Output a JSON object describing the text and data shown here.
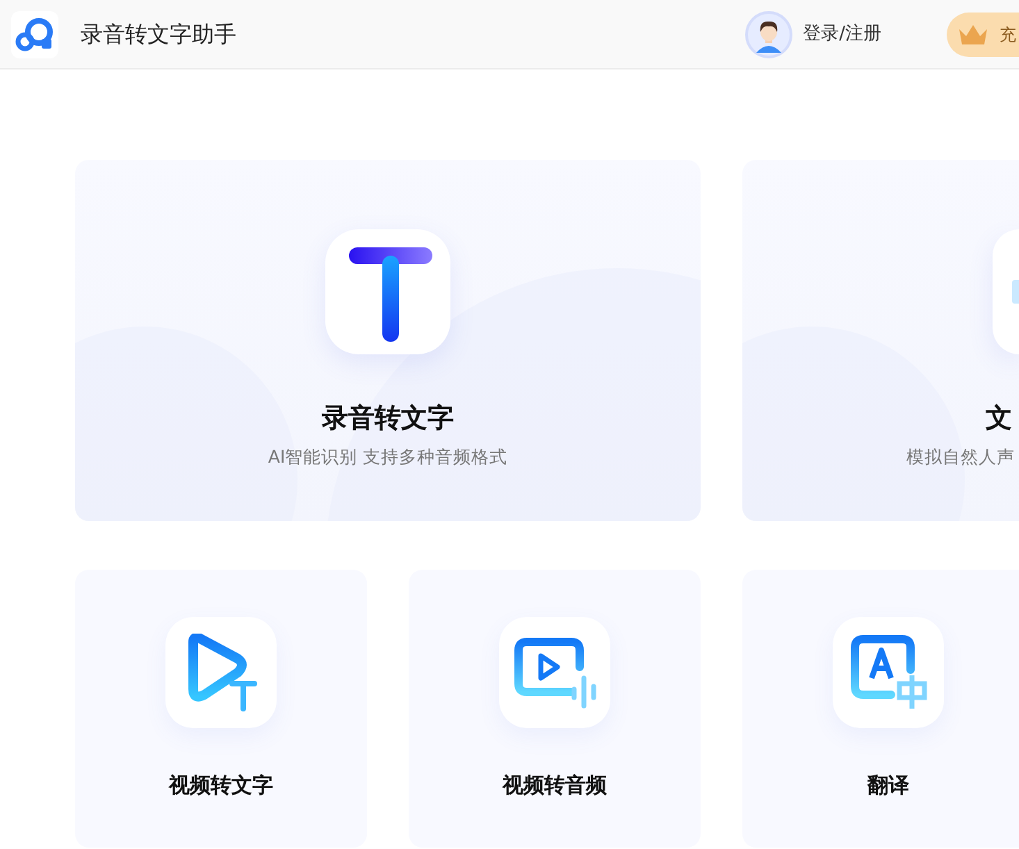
{
  "header": {
    "app_title": "录音转文字助手",
    "login": "登录/注册",
    "vip_button": "充"
  },
  "feature_cards": [
    {
      "title": "录音转文字",
      "subtitle": "AI智能识别 支持多种音频格式"
    },
    {
      "title": "文",
      "subtitle": "模拟自然人声"
    }
  ],
  "tool_cards": [
    {
      "title": "视频转文字"
    },
    {
      "title": "视频转音频"
    },
    {
      "title": "翻译"
    }
  ]
}
